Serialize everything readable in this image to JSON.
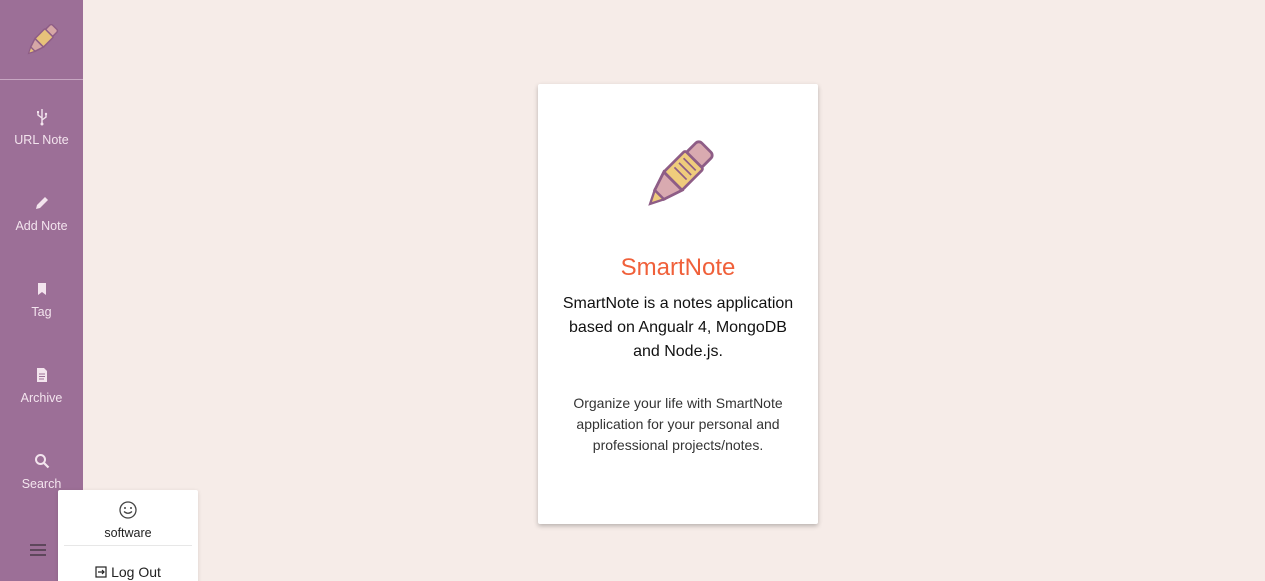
{
  "sidebar": {
    "logo_icon": "pen-logo-icon",
    "items": [
      {
        "label": "URL Note",
        "icon": "usb-icon"
      },
      {
        "label": "Add Note",
        "icon": "pencil-icon"
      },
      {
        "label": "Tag",
        "icon": "bookmark-icon"
      },
      {
        "label": "Archive",
        "icon": "document-icon"
      },
      {
        "label": "Search",
        "icon": "search-icon"
      }
    ],
    "menu_icon": "hamburger-menu-icon"
  },
  "user_popup": {
    "avatar_icon": "smile-icon",
    "username": "software",
    "logout_label": "Log Out",
    "logout_icon": "logout-icon"
  },
  "card": {
    "hero_icon": "pen-logo-icon",
    "title": "SmartNote",
    "description": "SmartNote is a notes application based on Angualr 4, MongoDB and Node.js.",
    "subtext": "Organize your life with SmartNote application for your personal and professional projects/notes."
  },
  "colors": {
    "sidebar_bg": "#9c6f97",
    "page_bg": "#f6ece8",
    "accent_title": "#f0603a"
  }
}
